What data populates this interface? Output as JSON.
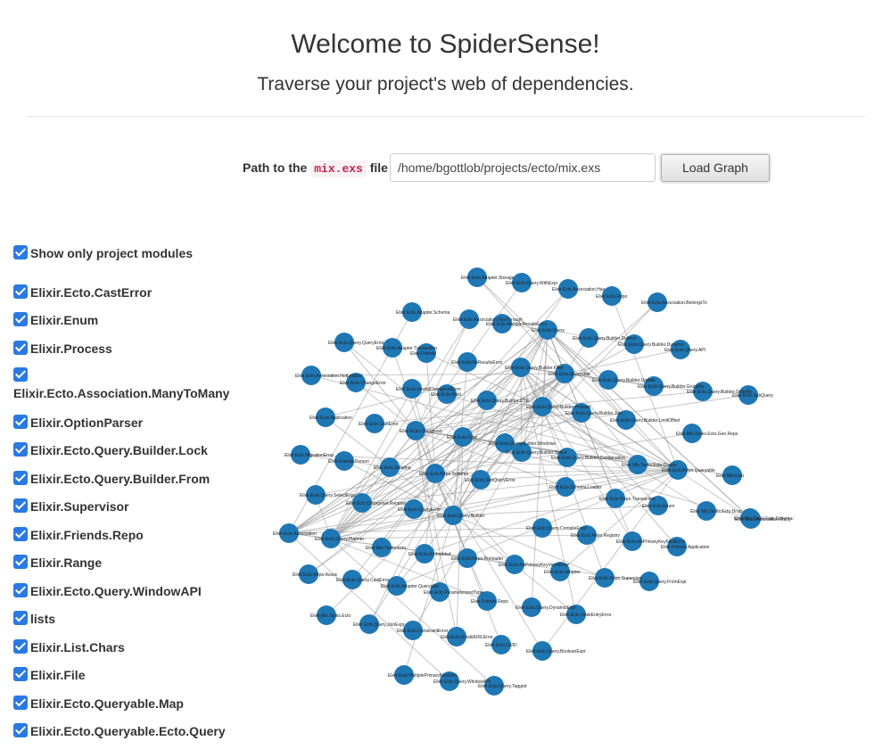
{
  "header": {
    "title": "Welcome to SpiderSense!",
    "subtitle": "Traverse your project's web of dependencies."
  },
  "path_form": {
    "label_prefix": "Path to the",
    "label_code": "mix.exs",
    "label_suffix": "file",
    "path_value": "/home/bgottlob/projects/ecto/mix.exs",
    "load_button": "Load Graph"
  },
  "sidebar": {
    "show_only_project_modules": {
      "label": "Show only project modules",
      "checked": true
    },
    "modules": [
      "Elixir.Ecto.CastError",
      "Elixir.Enum",
      "Elixir.Process",
      "Elixir.Ecto.Association.ManyToMany",
      "Elixir.OptionParser",
      "Elixir.Ecto.Query.Builder.Lock",
      "Elixir.Ecto.Query.Builder.From",
      "Elixir.Supervisor",
      "Elixir.Friends.Repo",
      "Elixir.Range",
      "Elixir.Ecto.Query.WindowAPI",
      "lists",
      "Elixir.List.Chars",
      "Elixir.File",
      "Elixir.Ecto.Queryable.Map",
      "Elixir.Ecto.Queryable.Ecto.Query"
    ]
  },
  "graph": {
    "node_color": "#1f77b4",
    "edge_color": "#999999",
    "nodes": [
      "Elixir.Ecto.Adapter.Storage",
      "Elixir.Ecto.Query.WithExpr",
      "Elixir.Ecto.Association.Has",
      "Elixir.Ecto.Repo",
      "Elixir.Ecto.Association.BelongsTo",
      "Elixir.Ecto.Adapter.Schema",
      "Elixir.Ecto.Association.HasThrough",
      "Elixir.Ecto.MultipleResultsError",
      "Elixir.Ecto.Query",
      "Elixir.Ecto.Query.Builder.Distinct",
      "Elixir.Ecto.Query.Builder.Dynamic",
      "Elixir.Ecto.Query.API",
      "Elixir.Ecto.Query.QueryError",
      "Elixir.Ecto.Adapter.Transaction",
      "Elixir.Friends",
      "Elixir.Ecto.NoResultsError",
      "Elixir.Ecto.Query.Builder.Filter",
      "Elixir.Ecto.Queryable",
      "Elixir.Ecto.Query.Builder.Update",
      "Elixir.Ecto.Query.Builder.GroupBy",
      "Elixir.Ecto.Query.Builder.OrderBy",
      "Elixir.Ecto.SubQuery",
      "Elixir.Ecto.Association.NotLoaded",
      "Elixir.Ecto.ChangeError",
      "Elixir.Ecto.InvalidChangesetError",
      "Elixir.Ecto.Multi",
      "Elixir.Ecto.Query.Builder.CTE",
      "Elixir.Ecto.Query.Builder.Preload",
      "Elixir.Ecto.Query.Builder.Join",
      "Elixir.Ecto.Query.Builder.LimitOffset",
      "Elixir.Ecto.Application",
      "Elixir.Ecto.CastError",
      "Elixir.Ecto.Changeset",
      "Elixir.Ecto.Type",
      "Elixir.Ecto.Query.Builder.Windows",
      "Elixir.Mix.Tasks.Ecto.Gen.Repo",
      "Elixir.Ecto.MigrationError",
      "Elixir.Friends.Person",
      "Elixir.Ecto.Schema",
      "Elixir.Ecto.Repo.Schema",
      "Elixir.Ecto.Query.Builder.Select",
      "Elixir.Ecto.Query.Builder.Combination",
      "Elixir.Mix.Tasks.Ecto.Create",
      "Elixir.Ecto.Repo.Queryable",
      "Elixir.Ecto.SubQueryError",
      "Elixir.Mix.Ecto",
      "Elixir.Ecto.Query.SelectExpr",
      "Elixir.Ecto.Changeset.Relation",
      "Elixir.Ecto.QueryError",
      "Elixir.Ecto.Query.Builder",
      "Elixir.Ecto.Schema.Loader",
      "Elixir.Ecto.Repo.Transaction",
      "Elixir.Ecto.Enum",
      "Elixir.Mix.Tasks.Ecto.Drop",
      "Elixir.Ecto.Association.Many",
      "Elixir.Ecto.Association",
      "Elixir.Ecto.Query.Planner",
      "Elixir.Mix.Tasks.Ecto",
      "Elixir.Ecto.Embedded",
      "Elixir.Ecto.Repo.Preloader",
      "Elixir.Ecto.Query.CompileError",
      "Elixir.Ecto.Repo.Registry",
      "Elixir.Ecto.NoPrimaryKeyFieldError",
      "Elixir.Friends.Application",
      "Elixir.Ecto.Repo.Assoc",
      "Elixir.Ecto.Query.CastError",
      "Elixir.Ecto.Adapter.Queryable",
      "Elixir.Ecto.ParameterizedType",
      "Elixir.Ecto.NoPrimaryKeyValueError",
      "Elixir.Ecto.Adapter",
      "Elixir.Ecto.Repo.Supervisor",
      "Elixir.Ecto.Query.FromExpr",
      "Elixir.Friends.Repo",
      "Elixir.Ecto.Query.DynamicExpr",
      "Elixir.Ecto.StaleEntryError",
      "Elixir.Mix.Tasks.Ecto",
      "Elixir.Ecto.Query.JoinExpr",
      "Elixir.Ecto.ConstraintError",
      "Elixir.Ecto.InvalidURLError",
      "Elixir.Ecto.UUID",
      "Elixir.Ecto.Query.BooleanExpr",
      "Elixir.Ecto.MultiplePrimaryKeyError",
      "Elixir.Ecto.Query.WindowAPI",
      "Elixir.Ecto.Query.Tagged",
      "Elixir.Mix.Tasks.Ecto.Schema.Me"
    ]
  }
}
